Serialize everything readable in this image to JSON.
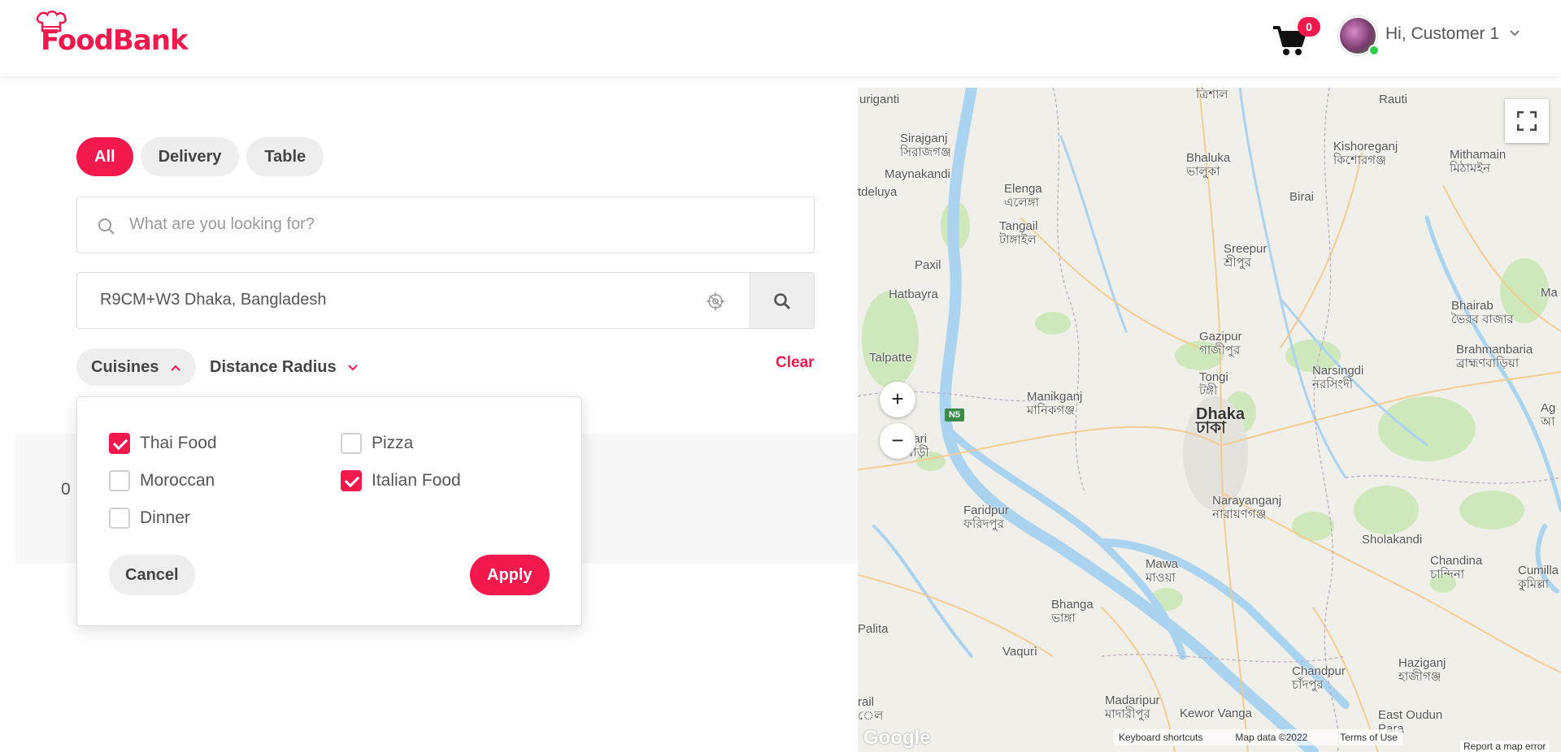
{
  "header": {
    "brand": "FoodBank",
    "cart_count": "0",
    "greeting": "Hi, Customer 1"
  },
  "tabs": [
    {
      "label": "All",
      "active": true
    },
    {
      "label": "Delivery",
      "active": false
    },
    {
      "label": "Table",
      "active": false
    }
  ],
  "search": {
    "placeholder": "What are you looking for?",
    "value": ""
  },
  "location": {
    "value": "R9CM+W3 Dhaka, Bangladesh"
  },
  "filters": {
    "cuisines_label": "Cuisines",
    "distance_label": "Distance Radius",
    "clear_label": "Clear",
    "stray_text": "0"
  },
  "cuisine_dropdown": {
    "options": [
      {
        "label": "Thai Food",
        "checked": true
      },
      {
        "label": "Pizza",
        "checked": false
      },
      {
        "label": "Moroccan",
        "checked": false
      },
      {
        "label": "Italian Food",
        "checked": true
      },
      {
        "label": "Dinner",
        "checked": false
      }
    ],
    "cancel_label": "Cancel",
    "apply_label": "Apply"
  },
  "map": {
    "zoom_in": "+",
    "zoom_out": "−",
    "road_shield": "N5",
    "google_logo": "Google",
    "keyboard_shortcuts": "Keyboard shortcuts",
    "map_data": "Map data ©2022",
    "terms": "Terms of Use",
    "report": "Report a map error",
    "places": [
      {
        "name": "uriganti",
        "bn": ""
      },
      {
        "name": "",
        "bn": "ত্রিশাল"
      },
      {
        "name": "Rauti",
        "bn": ""
      },
      {
        "name": "Sirajganj",
        "bn": "সিরাজগঞ্জ"
      },
      {
        "name": "Bhaluka",
        "bn": "ভালুকা"
      },
      {
        "name": "Kishoreganj",
        "bn": "কিশোরগঞ্জ"
      },
      {
        "name": "Mithamain",
        "bn": "মিঠামইন"
      },
      {
        "name": "Maynakandi",
        "bn": ""
      },
      {
        "name": "tdeluya",
        "bn": ""
      },
      {
        "name": "Elenga",
        "bn": "এলেঙ্গা"
      },
      {
        "name": "Birai",
        "bn": ""
      },
      {
        "name": "Tangail",
        "bn": "টাঙ্গাইল"
      },
      {
        "name": "Sreepur",
        "bn": "শ্রীপুর"
      },
      {
        "name": "Paxil",
        "bn": ""
      },
      {
        "name": "Hatbayra",
        "bn": ""
      },
      {
        "name": "Bhairab",
        "bn": "ভৈরব বাজার"
      },
      {
        "name": "Ma",
        "bn": ""
      },
      {
        "name": "Gazipur",
        "bn": "গাজীপুর"
      },
      {
        "name": "Brahmanbaria",
        "bn": "ব্রাহ্মণবাড়িয়া"
      },
      {
        "name": "Talpatte",
        "bn": ""
      },
      {
        "name": "Narsingdi",
        "bn": "নরসিংদী"
      },
      {
        "name": "Tongi",
        "bn": "টঙ্গী"
      },
      {
        "name": "Manikganj",
        "bn": "মানিকগঞ্জ"
      },
      {
        "name": "Ag",
        "bn": "আ"
      },
      {
        "name": "Dhaka",
        "bn": "ঢাকা"
      },
      {
        "name": "bari",
        "bn": "বাড়ী"
      },
      {
        "name": "Faridpur",
        "bn": "ফরিদপুর"
      },
      {
        "name": "Narayanganj",
        "bn": "নারায়ণগঞ্জ"
      },
      {
        "name": "Sholakandi",
        "bn": ""
      },
      {
        "name": "Mawa",
        "bn": "মাওয়া"
      },
      {
        "name": "Chandina",
        "bn": "চান্দিনা"
      },
      {
        "name": "Cumilla",
        "bn": "কুমিল্লা"
      },
      {
        "name": "Bhanga",
        "bn": "ভাঙ্গা"
      },
      {
        "name": "Palita",
        "bn": ""
      },
      {
        "name": "Vaqurì",
        "bn": ""
      },
      {
        "name": "Chandpur",
        "bn": "চাঁদপুর"
      },
      {
        "name": "Haziganj",
        "bn": "হাজীগঞ্জ"
      },
      {
        "name": "rail",
        "bn": "েল"
      },
      {
        "name": "Madaripur",
        "bn": "মাদারীপুর"
      },
      {
        "name": "Kewor Vanga",
        "bn": ""
      },
      {
        "name": "East Oudun",
        "bn": "Para"
      }
    ]
  },
  "colors": {
    "brand": "#f3194d",
    "water": "#aad3f0",
    "land": "#f1efe9",
    "greenery": "#c8e6b4"
  }
}
